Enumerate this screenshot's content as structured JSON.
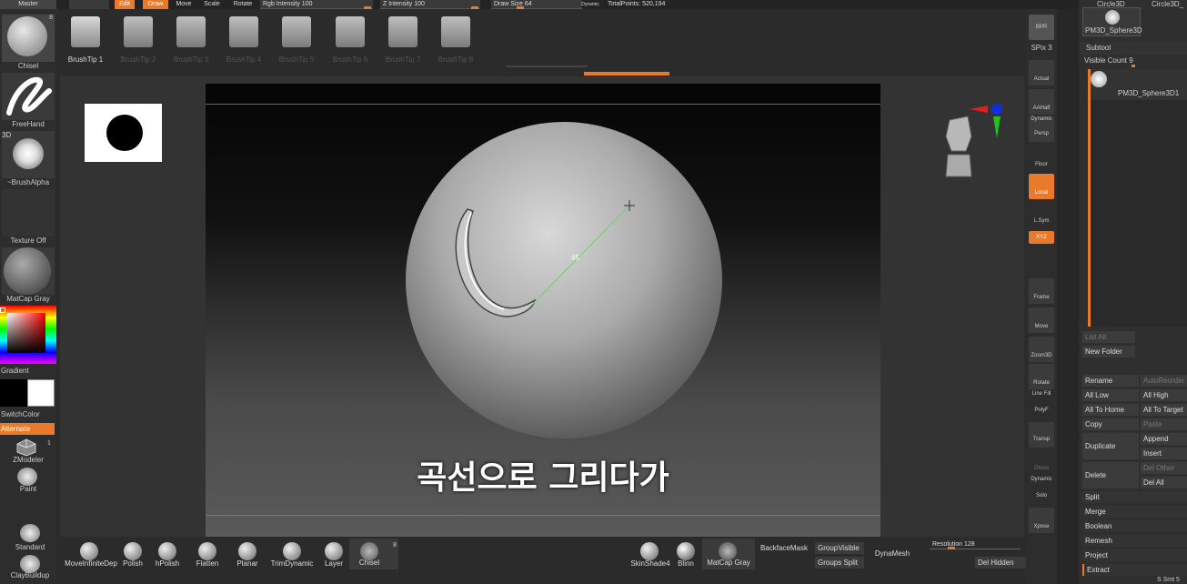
{
  "top": {
    "master": "Master",
    "edit": "Edit",
    "draw": "Draw",
    "move": "Move",
    "scale": "Scale",
    "rotate": "Rotate",
    "rgb": "Rgb Intensity 100",
    "z": "Z Intensity 100",
    "drawsize": "Draw Size 64",
    "dynamic": "Dynamic",
    "total": "TotalPoints: 520,194"
  },
  "left": {
    "chisel": "Chisel",
    "chisel_count": "8",
    "freehand": "FreeHand",
    "brushalpha": "~BrushAlpha",
    "b3d": "3D",
    "texture": "Texture Off",
    "matcap": "MatCap Gray",
    "gradient": "Gradient",
    "switch": "SwitchColor",
    "alternate": "Alternate",
    "zmodeler": "ZModeler",
    "zm_count": "1",
    "paint": "Paint",
    "standard": "Standard",
    "claybuildup": "ClayBuildup"
  },
  "tips": [
    "BrushTip 1",
    "BrushTip 2",
    "BrushTip 3",
    "BrushTip 4",
    "BrushTip 5",
    "BrushTip 6",
    "BrushTip 7",
    "BrushTip 8"
  ],
  "canvas": {
    "angle": "45",
    "caption": "곡선으로 그리다가"
  },
  "shelf": {
    "bpr": "BPR",
    "spix": "SPix 3",
    "actual": "Actual",
    "aahalf": "AAHalf",
    "dynamic": "Dynamic",
    "persp": "Persp",
    "floor": "Floor",
    "local": "Local",
    "lsym": "L.Sym",
    "xyz": "XYZ",
    "frame": "Frame",
    "move": "Move",
    "zoom": "Zoom3D",
    "rotate": "Rotate",
    "linefill": "Line Fill",
    "polyf": "PolyF",
    "transp": "Transp",
    "ghost": "Ghost",
    "dynamic2": "Dynamic",
    "solo": "Solo",
    "xpose": "Xpose"
  },
  "right": {
    "circle1": "Circle3D",
    "circle2": "Circle3D_",
    "sphere_tab": "PM3D_Sphere3D",
    "subtool": "Subtool",
    "visible": "Visible Count 9",
    "item": "PM3D_Sphere3D1",
    "listall": "List All",
    "newfolder": "New Folder",
    "rename": "Rename",
    "autoreorder": "AutoReorder",
    "alllow": "All Low",
    "allhigh": "All High",
    "alltohome": "All To Home",
    "alltotarget": "All To Target",
    "copy": "Copy",
    "paste": "Paste",
    "duplicate": "Duplicate",
    "append": "Append",
    "insert": "Insert",
    "delete": "Delete",
    "delother": "Del Other",
    "delall": "Del All",
    "split": "Split",
    "merge": "Merge",
    "boolean": "Boolean",
    "remesh": "Remesh",
    "project": "Project",
    "extract": "Extract",
    "ssmt": "S Smt 5"
  },
  "bottom": {
    "move": "MoveInfiniteDep",
    "polish": "Polish",
    "hpolish": "hPolish",
    "flatten": "Flatten",
    "planar": "Planar",
    "trim": "TrimDynamic",
    "layer": "Layer",
    "chisel": "Chisel",
    "count": "8",
    "skin": "SkinShade4",
    "blinn": "Blinn",
    "matcap": "MatCap Gray",
    "backface": "BackfaceMask",
    "groupvis": "GroupVisible",
    "groupsplit": "Groups Split",
    "dynamesh": "DynaMesh",
    "resolution": "Resolution 128",
    "delhidden": "Del Hidden"
  },
  "colors": {
    "accent": "#e9792b"
  }
}
